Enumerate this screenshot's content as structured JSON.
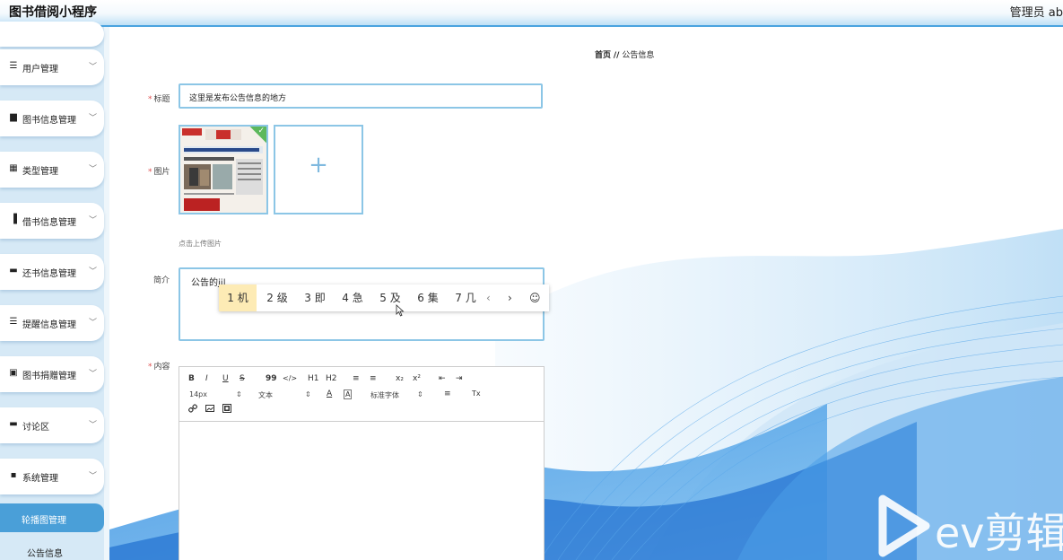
{
  "header": {
    "app_title": "图书借阅小程序",
    "user_label": "管理员 ab"
  },
  "sidebar": {
    "items": [
      {
        "label": "用户管理",
        "icon": "list-icon",
        "glyph": "☰"
      },
      {
        "label": "图书信息管理",
        "icon": "book-icon",
        "glyph": "▆"
      },
      {
        "label": "类型管理",
        "icon": "grid-icon",
        "glyph": "▦"
      },
      {
        "label": "借书信息管理",
        "icon": "bar-chart-icon",
        "glyph": "▐"
      },
      {
        "label": "还书信息管理",
        "icon": "monitor-icon",
        "glyph": "▬"
      },
      {
        "label": "提醒信息管理",
        "icon": "list-icon",
        "glyph": "☰"
      },
      {
        "label": "图书捐赠管理",
        "icon": "clipboard-icon",
        "glyph": "▣"
      },
      {
        "label": "讨论区",
        "icon": "chat-icon",
        "glyph": "▬"
      },
      {
        "label": "系统管理",
        "icon": "apps-icon",
        "glyph": "▪"
      }
    ],
    "caret": "﹀",
    "sub_active": "轮播图管理",
    "sub_item": "公告信息"
  },
  "breadcrumb": {
    "home": "首页",
    "separator": "//",
    "current": "公告信息"
  },
  "form": {
    "title_label": "标题",
    "title_value": "这里是发布公告信息的地方",
    "image_label": "图片",
    "upload_plus": "+",
    "upload_tip": "点击上传图片",
    "check_glyph": "✓",
    "intro_label": "简介",
    "intro_value": "公告的ji|",
    "content_label": "内容",
    "required_mark": "*"
  },
  "ime": {
    "candidates": [
      "1 机",
      "2 级",
      "3 即",
      "4 急",
      "5 及",
      "6 集",
      "7 几"
    ],
    "prev": "‹",
    "next": "›",
    "emoji": "☺"
  },
  "editor": {
    "row1": [
      "B",
      "I",
      "U",
      "S",
      "99",
      "</>",
      "H1",
      "H2",
      "≡",
      "≡",
      "x₂",
      "x²",
      "⇤",
      "⇥"
    ],
    "size_value": "14px",
    "heading_value": "文本",
    "font_value": "标准字体",
    "sel_caret": "⇕",
    "row2_tools": [
      "A",
      "A",
      "≡",
      "Tx"
    ],
    "row3_tools": [
      "link-icon",
      "image-icon",
      "video-icon"
    ]
  },
  "watermark": {
    "text": "ev剪辑"
  },
  "colors": {
    "accent": "#4a9fd8",
    "border": "#8cc6e6",
    "sidebar_bg": "#d6e9f6",
    "ime_highlight": "#fdebb5",
    "required": "#e05050"
  }
}
